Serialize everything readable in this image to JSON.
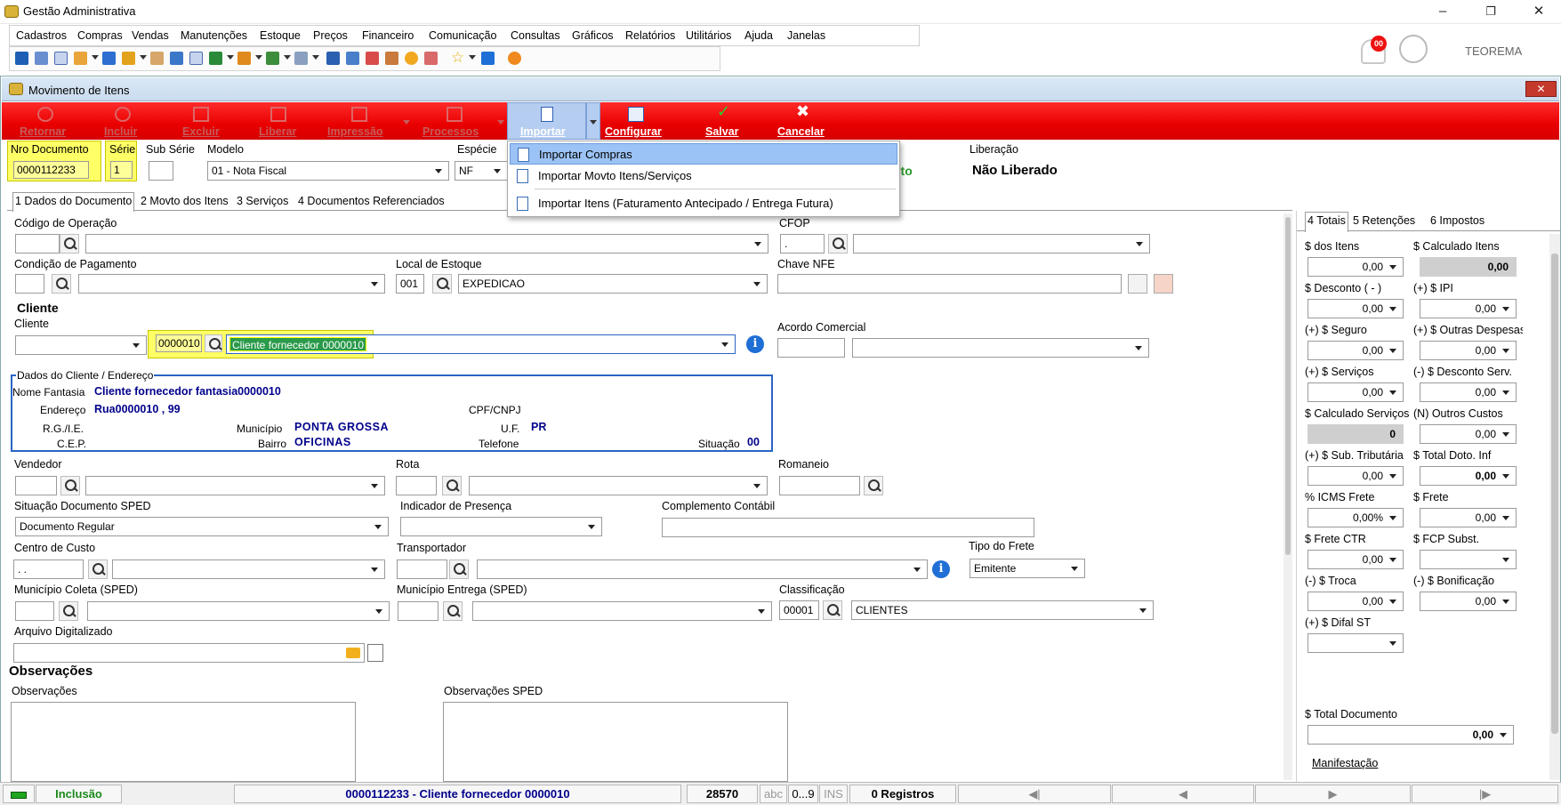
{
  "app": {
    "title": "Gestão Administrativa",
    "brand": "TEOREMA",
    "notif_count": "00"
  },
  "menu": [
    "Cadastros",
    "Compras",
    "Vendas",
    "Manutenções",
    "Estoque",
    "Preços",
    "Financeiro",
    "Comunicação",
    "Consultas",
    "Gráficos",
    "Relatórios",
    "Utilitários",
    "Ajuda",
    "Janelas"
  ],
  "child": {
    "title": "Movimento de Itens"
  },
  "actions": {
    "retornar": "Retornar",
    "incluir": "Incluir",
    "excluir": "Excluir",
    "liberar": "Liberar",
    "impressao": "Impressão",
    "processos": "Processos",
    "importar": "Importar",
    "configurar": "Configurar",
    "salvar": "Salvar",
    "cancelar": "Cancelar"
  },
  "import_menu": [
    "Importar Compras",
    "Importar Movto Itens/Serviços",
    "Importar Itens (Faturamento Antecipado / Entrega Futura)"
  ],
  "header": {
    "nro_label": "Nro Documento",
    "nro": "0000112233",
    "serie_label": "Série",
    "serie": "1",
    "subserie_label": "Sub Série",
    "modelo_label": "Modelo",
    "modelo": "01 - Nota Fiscal",
    "especie_label": "Espécie",
    "especie": "NF",
    "status_partial": "nto",
    "liberacao_label": "Liberação",
    "liberacao": "Não Liberado"
  },
  "tabs": [
    "1 Dados do Documento",
    "2 Movto dos Itens",
    "3 Serviços",
    "4 Documentos Referenciados"
  ],
  "form": {
    "cod_op": "Código de Operação",
    "cfop": "CFOP",
    "cfop_val": ".",
    "cond_pag": "Condição de Pagamento",
    "local_estoque": "Local de Estoque",
    "local_code": "001",
    "local_name": "EXPEDICAO",
    "chave_nfe": "Chave NFE",
    "cliente_heading": "Cliente",
    "cliente_label": "Cliente",
    "cliente_code": "0000010",
    "cliente_name": "Cliente fornecedor 0000010",
    "acordo": "Acordo Comercial",
    "dados_title": "Dados do Cliente / Endereço",
    "nome_fantasia_lbl": "Nome Fantasia",
    "nome_fantasia": "Cliente fornecedor fantasia0000010",
    "endereco_lbl": "Endereço",
    "endereco": "Rua0000010 , 99",
    "cpf_lbl": "CPF/CNPJ",
    "rg_lbl": "R.G./I.E.",
    "municipio_lbl": "Município",
    "municipio": "PONTA GROSSA",
    "uf_lbl": "U.F.",
    "uf": "PR",
    "cep_lbl": "C.E.P.",
    "bairro_lbl": "Bairro",
    "bairro": "OFICINAS",
    "telefone_lbl": "Telefone",
    "situacao_lbl": "Situação",
    "situacao": "00",
    "vendedor": "Vendedor",
    "rota": "Rota",
    "romaneio": "Romaneio",
    "sit_sped": "Situação Documento SPED",
    "sit_sped_val": "Documento Regular",
    "ind_presenca": "Indicador de Presença",
    "compl_contabil": "Complemento Contábil",
    "centro_custo": "Centro de Custo",
    "centro_val": ". .",
    "transportador": "Transportador",
    "tipo_frete": "Tipo do Frete",
    "tipo_frete_val": "Emitente",
    "mun_coleta": "Município Coleta (SPED)",
    "mun_entrega": "Município Entrega (SPED)",
    "classificacao": "Classificação",
    "class_code": "00001",
    "class_name": "CLIENTES",
    "arquivo": "Arquivo Digitalizado",
    "obs_heading": "Observações",
    "obs": "Observações",
    "obs_sped": "Observações SPED"
  },
  "side_tabs": [
    "4 Totais",
    "5 Retenções",
    "6 Impostos"
  ],
  "totals": [
    {
      "l": "$ dos Itens",
      "v": "0,00"
    },
    {
      "l": "$ Calculado Itens",
      "v": "0,00"
    },
    {
      "l": "$ Desconto ( - )",
      "v": "0,00"
    },
    {
      "l": "(+) $ IPI",
      "v": "0,00"
    },
    {
      "l": "(+) $ Seguro",
      "v": "0,00"
    },
    {
      "l": "(+) $ Outras Despesas",
      "v": "0,00"
    },
    {
      "l": "(+) $ Serviços",
      "v": "0,00"
    },
    {
      "l": "(-) $ Desconto Serv.",
      "v": "0,00"
    },
    {
      "l": "$ Calculado Serviços",
      "v": "0"
    },
    {
      "l": "(N) Outros Custos",
      "v": "0,00"
    },
    {
      "l": "(+) $ Sub. Tributária",
      "v": "0,00"
    },
    {
      "l": "$ Total Doto. Inf",
      "v": "0,00"
    },
    {
      "l": "% ICMS Frete",
      "v": "0,00%"
    },
    {
      "l": "$ Frete",
      "v": "0,00"
    },
    {
      "l": "$ Frete CTR",
      "v": "0,00"
    },
    {
      "l": "$ FCP Subst.",
      "v": ""
    },
    {
      "l": "(-) $ Troca",
      "v": "0,00"
    },
    {
      "l": "(-) $ Bonificação",
      "v": "0,00"
    },
    {
      "l": "(+) $ Difal ST",
      "v": ""
    }
  ],
  "total_doc": {
    "l": "$ Total Documento",
    "v": "0,00"
  },
  "manifestacao": "Manifestação",
  "status": {
    "mode": "Inclusão",
    "doc": "0000112233 - Cliente fornecedor 0000010",
    "num": "28570",
    "abc": "abc",
    "range": "0...9",
    "ins": "INS",
    "registros": "0 Registros"
  }
}
